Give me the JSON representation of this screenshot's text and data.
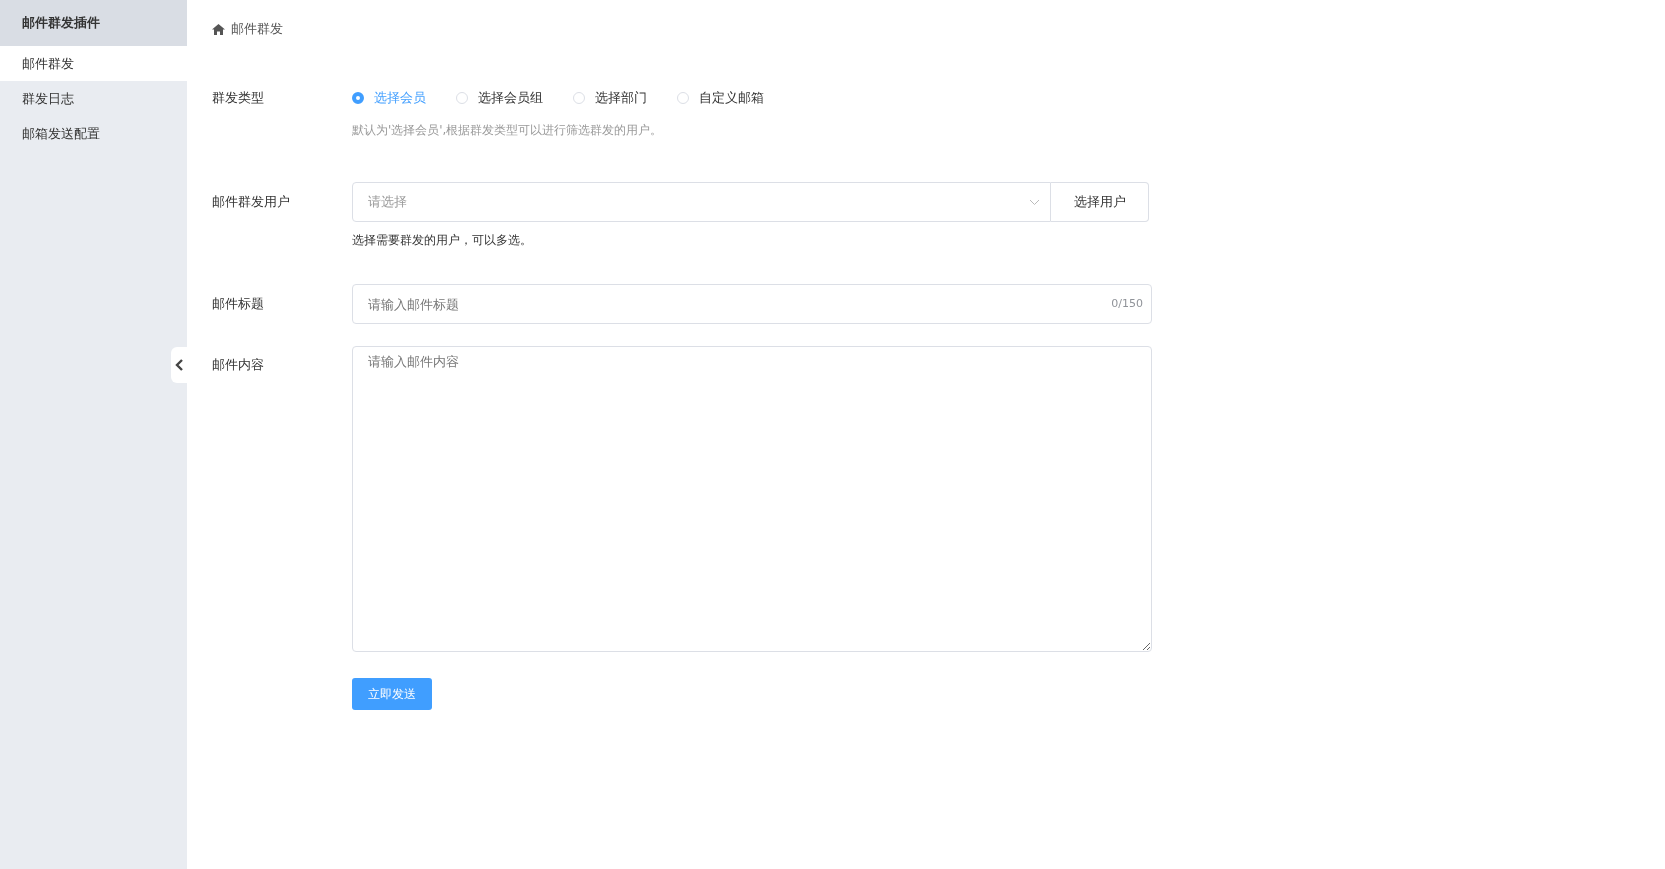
{
  "sidebar": {
    "title": "邮件群发插件",
    "items": [
      {
        "label": "邮件群发",
        "selected": true
      },
      {
        "label": "群发日志",
        "selected": false
      },
      {
        "label": "邮箱发送配置",
        "selected": false
      }
    ]
  },
  "breadcrumb": "邮件群发",
  "form": {
    "send_type": {
      "label": "群发类型",
      "options": [
        {
          "label": "选择会员",
          "selected": true
        },
        {
          "label": "选择会员组",
          "selected": false
        },
        {
          "label": "选择部门",
          "selected": false
        },
        {
          "label": "自定义邮箱",
          "selected": false
        }
      ],
      "hint": "默认为'选择会员',根据群发类型可以进行筛选群发的用户。"
    },
    "users": {
      "label": "邮件群发用户",
      "placeholder": "请选择",
      "button": "选择用户",
      "help": "选择需要群发的用户，可以多选。"
    },
    "subject": {
      "label": "邮件标题",
      "placeholder": "请输入邮件标题",
      "counter": "0/150"
    },
    "content": {
      "label": "邮件内容",
      "placeholder": "请输入邮件内容"
    },
    "submit": "立即发送"
  }
}
